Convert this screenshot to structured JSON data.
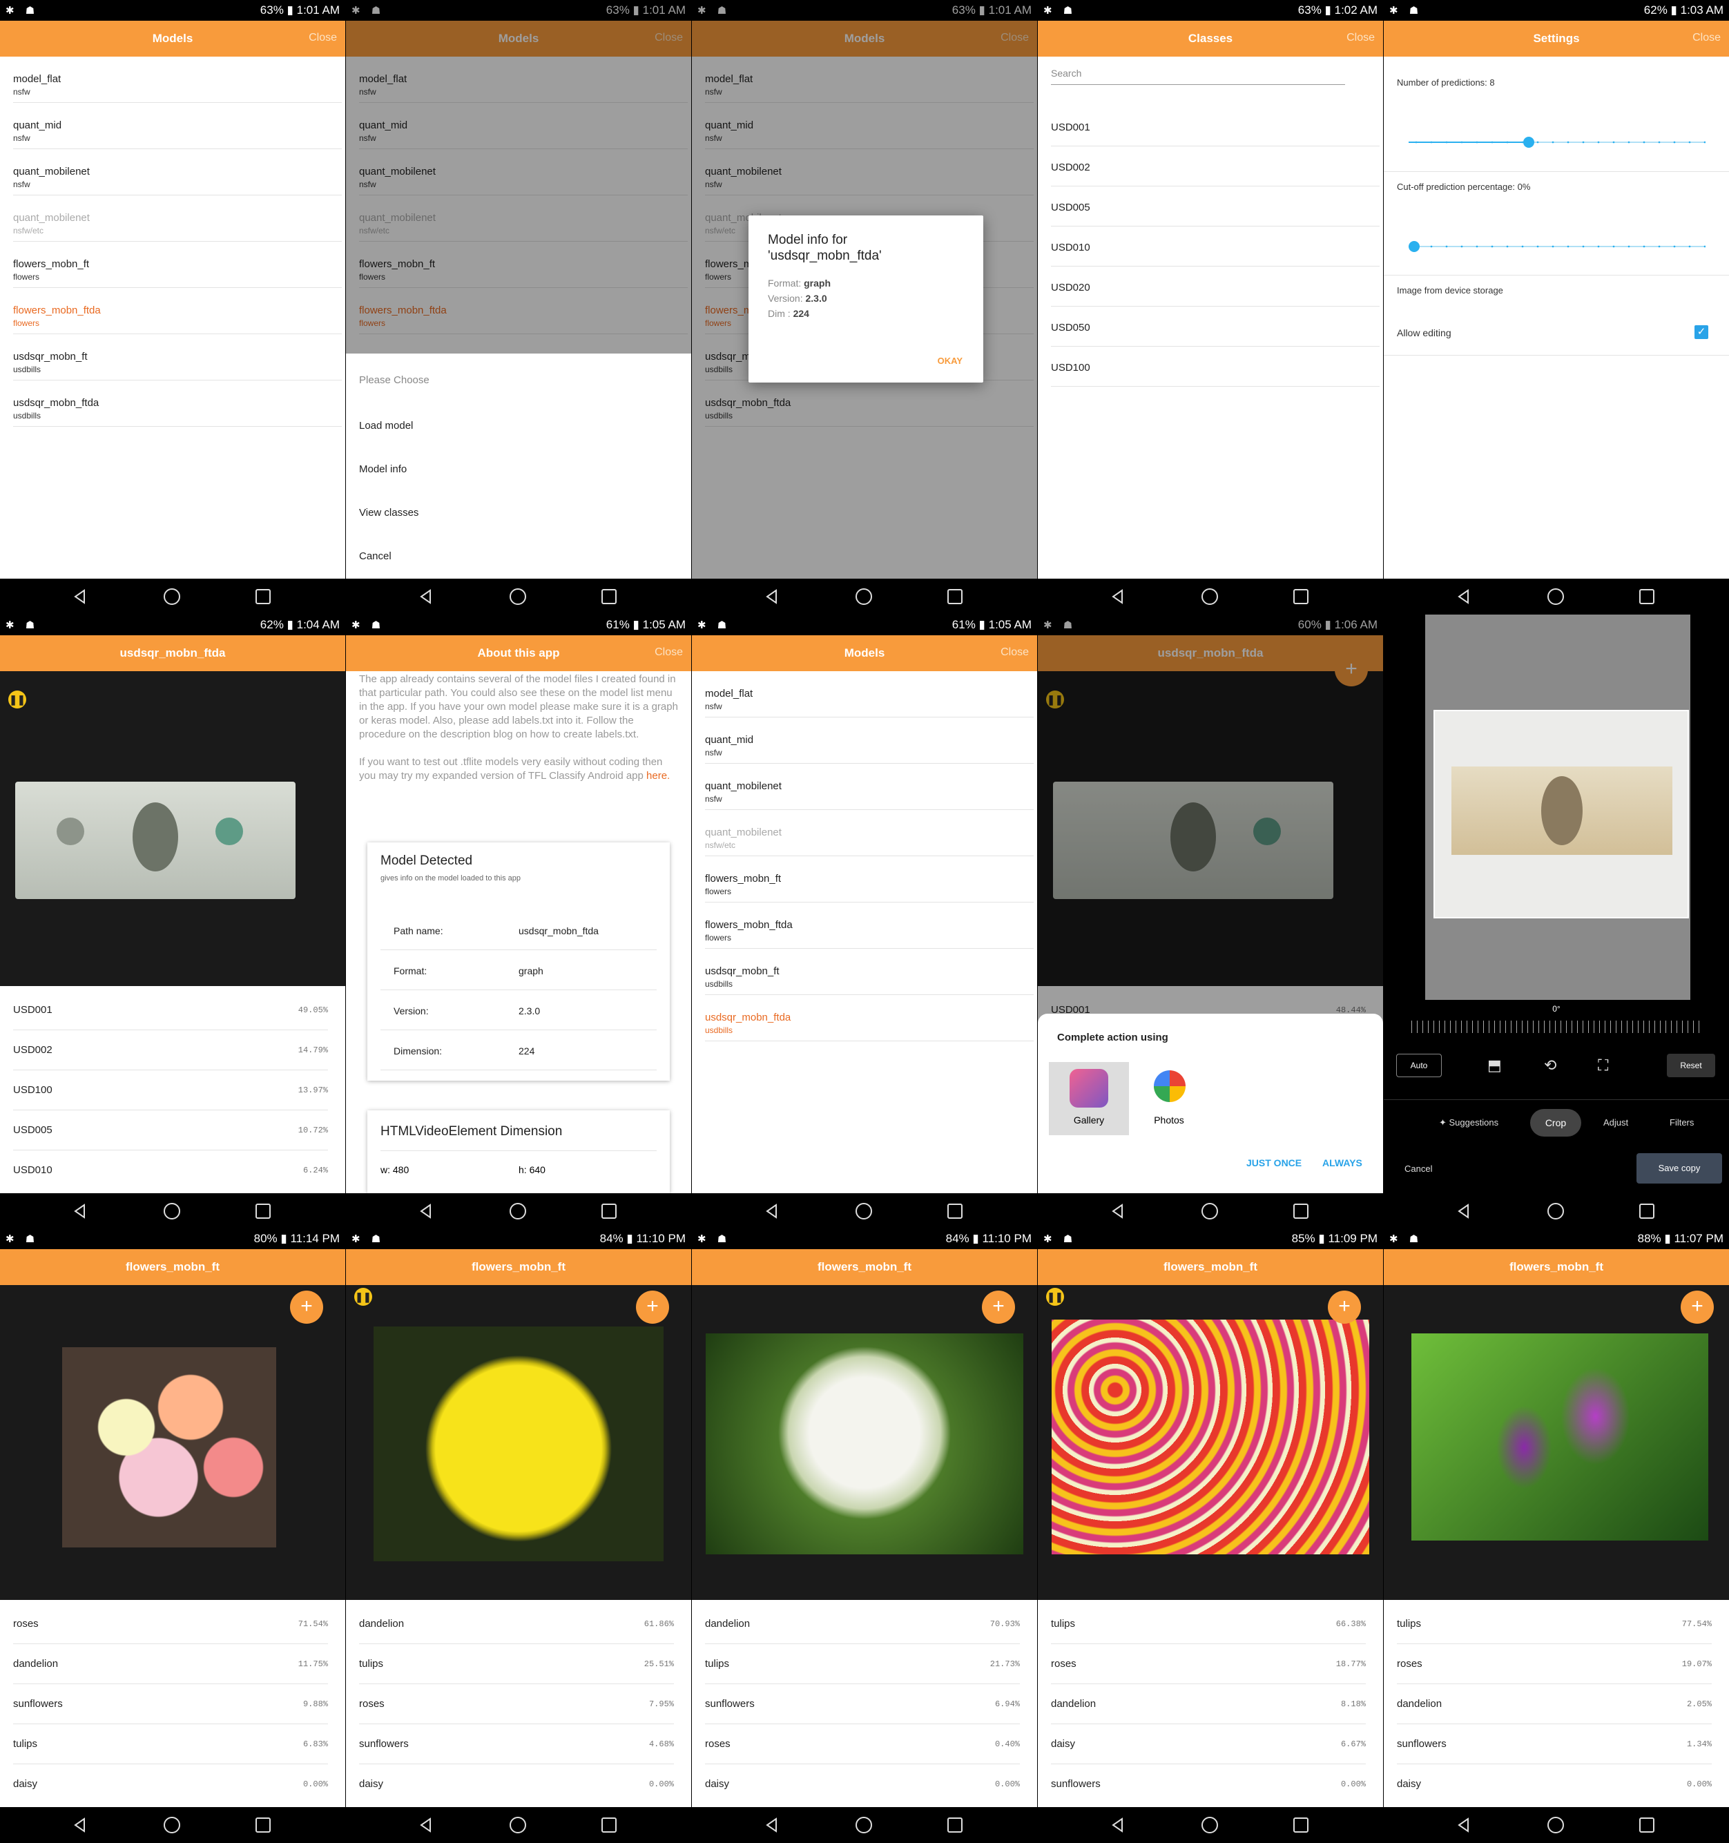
{
  "status": {
    "p00": {
      "battery": "63%",
      "time": "1:01 AM"
    },
    "p01": {
      "battery": "63%",
      "time": "1:01 AM"
    },
    "p02": {
      "battery": "63%",
      "time": "1:01 AM"
    },
    "p03": {
      "battery": "63%",
      "time": "1:02 AM"
    },
    "p04": {
      "battery": "62%",
      "time": "1:03 AM"
    },
    "p10": {
      "battery": "62%",
      "time": "1:04 AM"
    },
    "p11": {
      "battery": "61%",
      "time": "1:05 AM"
    },
    "p12": {
      "battery": "61%",
      "time": "1:05 AM"
    },
    "p13": {
      "battery": "60%",
      "time": "1:06 AM"
    },
    "p20": {
      "battery": "80%",
      "time": "11:14 PM"
    },
    "p21": {
      "battery": "84%",
      "time": "11:10 PM"
    },
    "p22": {
      "battery": "84%",
      "time": "11:10 PM"
    },
    "p23": {
      "battery": "85%",
      "time": "11:09 PM"
    },
    "p24": {
      "battery": "88%",
      "time": "11:07 PM"
    }
  },
  "appbar": {
    "models": "Models",
    "classes": "Classes",
    "settings": "Settings",
    "about": "About this app",
    "close": "Close",
    "usd_model": "usdsqr_mobn_ftda",
    "flowers_model": "flowers_mobn_ft"
  },
  "models": [
    {
      "name": "model_flat",
      "sub": "nsfw"
    },
    {
      "name": "quant_mid",
      "sub": "nsfw"
    },
    {
      "name": "quant_mobilenet",
      "sub": "nsfw"
    },
    {
      "name": "quant_mobilenet",
      "sub": "nsfw/etc"
    },
    {
      "name": "flowers_mobn_ft",
      "sub": "flowers"
    },
    {
      "name": "flowers_mobn_ftda",
      "sub": "flowers"
    },
    {
      "name": "usdsqr_mobn_ft",
      "sub": "usdbills"
    },
    {
      "name": "usdsqr_mobn_ftda",
      "sub": "usdbills"
    }
  ],
  "menu": {
    "header": "Please Choose",
    "load": "Load model",
    "info": "Model info",
    "view": "View classes",
    "cancel": "Cancel"
  },
  "dialog": {
    "title": "Model info for 'usdsqr_mobn_ftda'",
    "format_label": "Format:",
    "format": "graph",
    "version_label": "Version:",
    "version": "2.3.0",
    "dim_label": "Dim :",
    "dim": "224",
    "ok": "OKAY"
  },
  "classes": {
    "search_placeholder": "Search",
    "items": [
      "USD001",
      "USD002",
      "USD005",
      "USD010",
      "USD020",
      "USD050",
      "USD100"
    ]
  },
  "settings": {
    "num_pred": "Number of predictions: 8",
    "num_pred_value": 8,
    "num_pred_max": 20,
    "cutoff": "Cut-off prediction percentage: 0%",
    "cutoff_value": 0,
    "image_storage": "Image from device storage",
    "allow_editing": "Allow editing"
  },
  "usd_preds": [
    {
      "label": "USD001",
      "value": "49.05%"
    },
    {
      "label": "USD002",
      "value": "14.79%"
    },
    {
      "label": "USD100",
      "value": "13.97%"
    },
    {
      "label": "USD005",
      "value": "10.72%"
    },
    {
      "label": "USD010",
      "value": "6.24%"
    }
  ],
  "about": {
    "p1": "The app already contains several of the model files I created found in that particular path. You could also see these on the model list menu in the app. If you have your own model please make sure it is a graph or keras model. Also, please add labels.txt into it. Follow the procedure on the description blog on how to create labels.txt.",
    "p2a": "If you want to test out .tflite models very easily without coding then you may try my expanded version of TFL Classify Android app ",
    "p2link": "here.",
    "card_title": "Model Detected",
    "card_sub": "gives info on the model loaded to this app",
    "rows": [
      {
        "k": "Path name:",
        "v": "usdsqr_mobn_ftda"
      },
      {
        "k": "Format:",
        "v": "graph"
      },
      {
        "k": "Version:",
        "v": "2.3.0"
      },
      {
        "k": "Dimension:",
        "v": "224"
      }
    ],
    "card2_title": "HTMLVideoElement Dimension",
    "w": "w: 480",
    "h": "h: 640"
  },
  "chooser": {
    "peek_label": "USD001",
    "peek_value": "48.44%",
    "title": "Complete action using",
    "gallery": "Gallery",
    "photos": "Photos",
    "once": "JUST ONCE",
    "always": "ALWAYS"
  },
  "crop": {
    "angle": "0°",
    "auto": "Auto",
    "reset": "Reset",
    "suggestions": "Suggestions",
    "crop": "Crop",
    "adjust": "Adjust",
    "filters": "Filters",
    "cancel": "Cancel",
    "save": "Save copy"
  },
  "flower_preds": [
    [
      {
        "label": "roses",
        "value": "71.54%"
      },
      {
        "label": "dandelion",
        "value": "11.75%"
      },
      {
        "label": "sunflowers",
        "value": "9.88%"
      },
      {
        "label": "tulips",
        "value": "6.83%"
      },
      {
        "label": "daisy",
        "value": "0.00%"
      }
    ],
    [
      {
        "label": "dandelion",
        "value": "61.86%"
      },
      {
        "label": "tulips",
        "value": "25.51%"
      },
      {
        "label": "roses",
        "value": "7.95%"
      },
      {
        "label": "sunflowers",
        "value": "4.68%"
      },
      {
        "label": "daisy",
        "value": "0.00%"
      }
    ],
    [
      {
        "label": "dandelion",
        "value": "70.93%"
      },
      {
        "label": "tulips",
        "value": "21.73%"
      },
      {
        "label": "sunflowers",
        "value": "6.94%"
      },
      {
        "label": "roses",
        "value": "0.40%"
      },
      {
        "label": "daisy",
        "value": "0.00%"
      }
    ],
    [
      {
        "label": "tulips",
        "value": "66.38%"
      },
      {
        "label": "roses",
        "value": "18.77%"
      },
      {
        "label": "dandelion",
        "value": "8.18%"
      },
      {
        "label": "daisy",
        "value": "6.67%"
      },
      {
        "label": "sunflowers",
        "value": "0.00%"
      }
    ],
    [
      {
        "label": "tulips",
        "value": "77.54%"
      },
      {
        "label": "roses",
        "value": "19.07%"
      },
      {
        "label": "dandelion",
        "value": "2.05%"
      },
      {
        "label": "sunflowers",
        "value": "1.34%"
      },
      {
        "label": "daisy",
        "value": "0.00%"
      }
    ]
  ],
  "colors": {
    "accent": "#f89b3c",
    "selected": "#e96a22",
    "slider": "#2ab0ef"
  },
  "icons": [
    "back-icon",
    "home-icon",
    "recents-icon",
    "pause-icon",
    "add-icon",
    "close-icon",
    "gear-icon",
    "info-icon",
    "refresh-icon",
    "list-icon",
    "gallery-icon",
    "document-icon",
    "checkbox-icon"
  ]
}
